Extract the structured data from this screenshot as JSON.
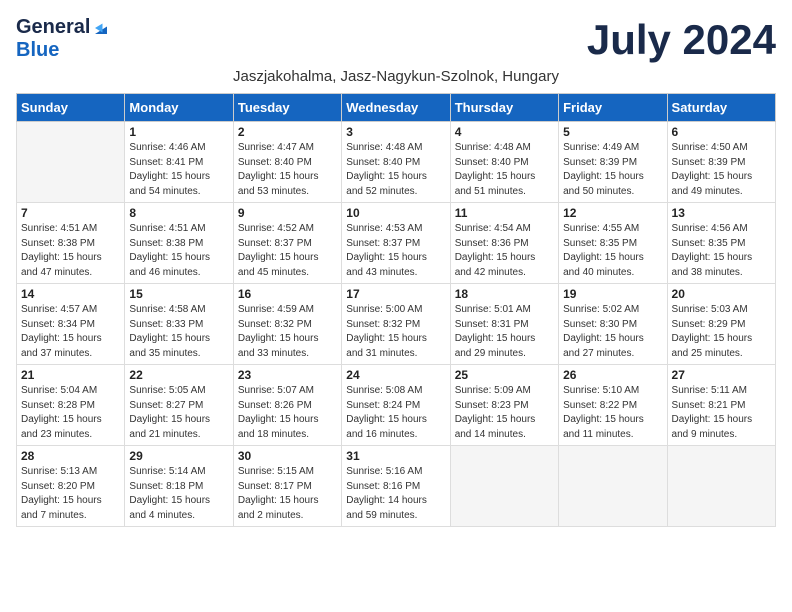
{
  "header": {
    "logo_general": "General",
    "logo_blue": "Blue",
    "month_title": "July 2024",
    "subtitle": "Jaszjakohalma, Jasz-Nagykun-Szolnok, Hungary"
  },
  "weekdays": [
    "Sunday",
    "Monday",
    "Tuesday",
    "Wednesday",
    "Thursday",
    "Friday",
    "Saturday"
  ],
  "weeks": [
    [
      {
        "day": "",
        "info": ""
      },
      {
        "day": "1",
        "info": "Sunrise: 4:46 AM\nSunset: 8:41 PM\nDaylight: 15 hours\nand 54 minutes."
      },
      {
        "day": "2",
        "info": "Sunrise: 4:47 AM\nSunset: 8:40 PM\nDaylight: 15 hours\nand 53 minutes."
      },
      {
        "day": "3",
        "info": "Sunrise: 4:48 AM\nSunset: 8:40 PM\nDaylight: 15 hours\nand 52 minutes."
      },
      {
        "day": "4",
        "info": "Sunrise: 4:48 AM\nSunset: 8:40 PM\nDaylight: 15 hours\nand 51 minutes."
      },
      {
        "day": "5",
        "info": "Sunrise: 4:49 AM\nSunset: 8:39 PM\nDaylight: 15 hours\nand 50 minutes."
      },
      {
        "day": "6",
        "info": "Sunrise: 4:50 AM\nSunset: 8:39 PM\nDaylight: 15 hours\nand 49 minutes."
      }
    ],
    [
      {
        "day": "7",
        "info": "Sunrise: 4:51 AM\nSunset: 8:38 PM\nDaylight: 15 hours\nand 47 minutes."
      },
      {
        "day": "8",
        "info": "Sunrise: 4:51 AM\nSunset: 8:38 PM\nDaylight: 15 hours\nand 46 minutes."
      },
      {
        "day": "9",
        "info": "Sunrise: 4:52 AM\nSunset: 8:37 PM\nDaylight: 15 hours\nand 45 minutes."
      },
      {
        "day": "10",
        "info": "Sunrise: 4:53 AM\nSunset: 8:37 PM\nDaylight: 15 hours\nand 43 minutes."
      },
      {
        "day": "11",
        "info": "Sunrise: 4:54 AM\nSunset: 8:36 PM\nDaylight: 15 hours\nand 42 minutes."
      },
      {
        "day": "12",
        "info": "Sunrise: 4:55 AM\nSunset: 8:35 PM\nDaylight: 15 hours\nand 40 minutes."
      },
      {
        "day": "13",
        "info": "Sunrise: 4:56 AM\nSunset: 8:35 PM\nDaylight: 15 hours\nand 38 minutes."
      }
    ],
    [
      {
        "day": "14",
        "info": "Sunrise: 4:57 AM\nSunset: 8:34 PM\nDaylight: 15 hours\nand 37 minutes."
      },
      {
        "day": "15",
        "info": "Sunrise: 4:58 AM\nSunset: 8:33 PM\nDaylight: 15 hours\nand 35 minutes."
      },
      {
        "day": "16",
        "info": "Sunrise: 4:59 AM\nSunset: 8:32 PM\nDaylight: 15 hours\nand 33 minutes."
      },
      {
        "day": "17",
        "info": "Sunrise: 5:00 AM\nSunset: 8:32 PM\nDaylight: 15 hours\nand 31 minutes."
      },
      {
        "day": "18",
        "info": "Sunrise: 5:01 AM\nSunset: 8:31 PM\nDaylight: 15 hours\nand 29 minutes."
      },
      {
        "day": "19",
        "info": "Sunrise: 5:02 AM\nSunset: 8:30 PM\nDaylight: 15 hours\nand 27 minutes."
      },
      {
        "day": "20",
        "info": "Sunrise: 5:03 AM\nSunset: 8:29 PM\nDaylight: 15 hours\nand 25 minutes."
      }
    ],
    [
      {
        "day": "21",
        "info": "Sunrise: 5:04 AM\nSunset: 8:28 PM\nDaylight: 15 hours\nand 23 minutes."
      },
      {
        "day": "22",
        "info": "Sunrise: 5:05 AM\nSunset: 8:27 PM\nDaylight: 15 hours\nand 21 minutes."
      },
      {
        "day": "23",
        "info": "Sunrise: 5:07 AM\nSunset: 8:26 PM\nDaylight: 15 hours\nand 18 minutes."
      },
      {
        "day": "24",
        "info": "Sunrise: 5:08 AM\nSunset: 8:24 PM\nDaylight: 15 hours\nand 16 minutes."
      },
      {
        "day": "25",
        "info": "Sunrise: 5:09 AM\nSunset: 8:23 PM\nDaylight: 15 hours\nand 14 minutes."
      },
      {
        "day": "26",
        "info": "Sunrise: 5:10 AM\nSunset: 8:22 PM\nDaylight: 15 hours\nand 11 minutes."
      },
      {
        "day": "27",
        "info": "Sunrise: 5:11 AM\nSunset: 8:21 PM\nDaylight: 15 hours\nand 9 minutes."
      }
    ],
    [
      {
        "day": "28",
        "info": "Sunrise: 5:13 AM\nSunset: 8:20 PM\nDaylight: 15 hours\nand 7 minutes."
      },
      {
        "day": "29",
        "info": "Sunrise: 5:14 AM\nSunset: 8:18 PM\nDaylight: 15 hours\nand 4 minutes."
      },
      {
        "day": "30",
        "info": "Sunrise: 5:15 AM\nSunset: 8:17 PM\nDaylight: 15 hours\nand 2 minutes."
      },
      {
        "day": "31",
        "info": "Sunrise: 5:16 AM\nSunset: 8:16 PM\nDaylight: 14 hours\nand 59 minutes."
      },
      {
        "day": "",
        "info": ""
      },
      {
        "day": "",
        "info": ""
      },
      {
        "day": "",
        "info": ""
      }
    ]
  ]
}
